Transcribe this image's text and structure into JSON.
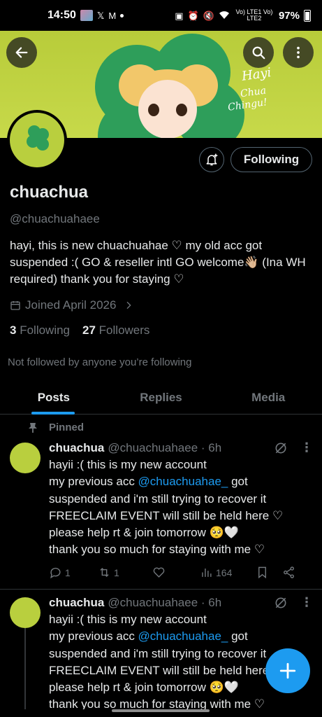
{
  "status_bar": {
    "time": "14:50",
    "network_label": "Vo) LTE1 Vo) LTE2",
    "battery": "97%"
  },
  "profile": {
    "name": "chuachua",
    "handle": "@chuachuahaee",
    "bio": "hayi, this is new chuachuahae ♡ my old acc got suspended :( GO & reseller intl GO welcome👋🏼 (Ina WH required) thank you for staying ♡",
    "joined": "Joined April 2026",
    "following_count": "3",
    "following_label": "Following",
    "followers_count": "27",
    "followers_label": "Followers",
    "not_followed": "Not followed by anyone you’re following",
    "follow_button": "Following",
    "banner_text_1": "Hayi",
    "banner_text_2": "Chua",
    "banner_text_3": "Chingu!"
  },
  "tabs": [
    {
      "label": "Posts",
      "active": true
    },
    {
      "label": "Replies",
      "active": false
    },
    {
      "label": "Media",
      "active": false
    }
  ],
  "pinned_label": "Pinned",
  "tweets": [
    {
      "name": "chuachua",
      "meta": "@chuachuahaee · 6h",
      "line1": "hayii :( this is my new account",
      "line2_pre": "my previous acc ",
      "mention": "@chuachuahae_",
      "line2_post": " got",
      "rest": "suspended and i'm still trying to recover it\nFREECLAIM EVENT will still be held here ♡\nplease help rt & join tomorrow 🥺🤍\nthank you so much for staying with me ♡",
      "replies": "1",
      "reposts": "1",
      "views": "164"
    },
    {
      "name": "chuachua",
      "meta": "@chuachuahaee · 6h",
      "line1": "hayii :( this is my new account",
      "line2_pre": "my previous acc ",
      "mention": "@chuachuahae_",
      "line2_post": " got",
      "rest": "suspended and i'm still trying to recover it\nFREECLAIM EVENT will still be held here ♡\nplease help rt & join tomorrow 🥺🤍\nthank you so much for staying with me ♡"
    }
  ],
  "colors": {
    "accent": "#1d9bf0",
    "banner": "#c7d94a",
    "clover": "#2e9e5a"
  }
}
